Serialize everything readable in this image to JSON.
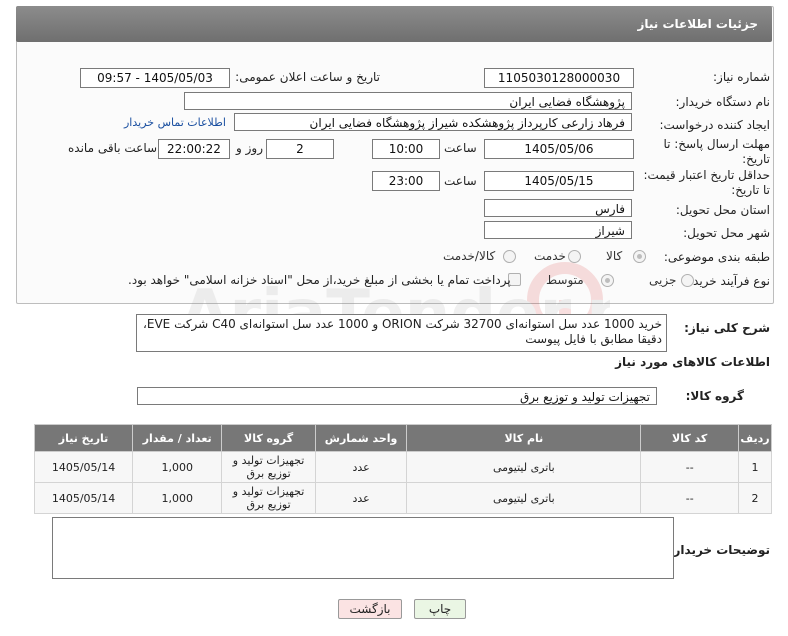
{
  "header": {
    "title": "جزئیات اطلاعات نیاز"
  },
  "fields": {
    "need_number_label": "شماره نیاز:",
    "need_number": "1105030128000030",
    "announce_label": "تاریخ و ساعت اعلان عمومی:",
    "announce_value": "1405/05/03 - 09:57",
    "buyer_label": "نام دستگاه خریدار:",
    "buyer_value": "پژوهشگاه فضایی ایران",
    "creator_label": "ایجاد کننده درخواست:",
    "creator_value": "فرهاد زارعی کارپرداز پژوهشکده شیراز پژوهشگاه فضایی ایران",
    "contact_link": "اطلاعات تماس خریدار",
    "deadline_label": "مهلت ارسال پاسخ: تا تاریخ:",
    "deadline_date": "1405/05/06",
    "time_label": "ساعت",
    "deadline_time": "10:00",
    "days_value": "2",
    "days_label": "روز و",
    "remaining_time": "22:00:22",
    "remaining_label": "ساعت باقی مانده",
    "validity_label": "حداقل تاریخ اعتبار قیمت: تا تاریخ:",
    "validity_date": "1405/05/15",
    "validity_time": "23:00",
    "province_label": "استان محل تحویل:",
    "province_value": "فارس",
    "city_label": "شهر محل تحویل:",
    "city_value": "شیراز",
    "category_label": "طبقه بندی موضوعی:",
    "category_options": [
      "کالا",
      "خدمت",
      "کالا/خدمت"
    ],
    "process_label": "نوع فرآیند خرید :",
    "process_options": [
      "جزیی",
      "متوسط"
    ],
    "payment_note": "پرداخت تمام یا بخشی از مبلغ خرید،از محل \"اسناد خزانه اسلامی\" خواهد بود."
  },
  "description": {
    "label": "شرح کلی نیاز:",
    "text": "خرید 1000 عدد سل استوانه‌ای 32700 شرکت ORION و 1000 عدد سل استوانه‌ای C40 شرکت EVE، دقیقا مطابق با فایل پیوست"
  },
  "goods_info_title": "اطلاعات کالاهای مورد نیاز",
  "goods_group": {
    "label": "گروه کالا:",
    "value": "تجهیزات تولید و توزیع برق"
  },
  "table": {
    "headers": [
      "ردیف",
      "کد کالا",
      "نام کالا",
      "واحد شمارش",
      "گروه کالا",
      "تعداد / مقدار",
      "تاریخ نیاز"
    ],
    "rows": [
      [
        "1",
        "--",
        "باتری لیتیومی",
        "عدد",
        "تجهیزات تولید و توزیع برق",
        "1,000",
        "1405/05/14"
      ],
      [
        "2",
        "--",
        "باتری لیتیومی",
        "عدد",
        "تجهیزات تولید و توزیع برق",
        "1,000",
        "1405/05/14"
      ]
    ]
  },
  "buyer_notes": {
    "label": "توضیحات خریدار:",
    "value": ""
  },
  "buttons": {
    "print": "چاپ",
    "back": "بازگشت"
  },
  "colors": {
    "header_bg": "#777777",
    "link": "#1a4fa0",
    "print_bg": "#eaf6e4",
    "back_bg": "#fbe3e3"
  }
}
